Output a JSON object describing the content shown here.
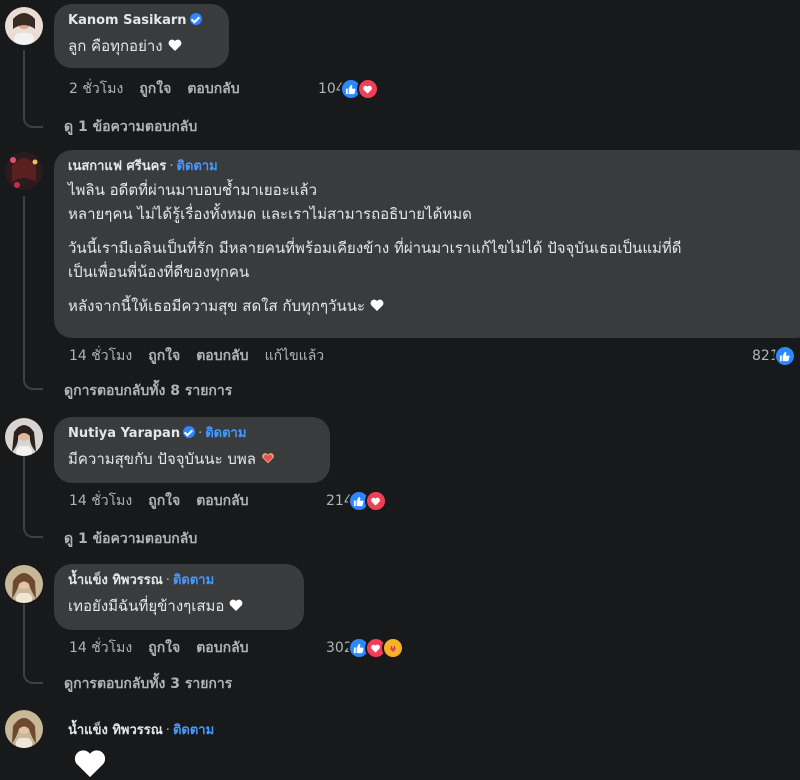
{
  "comments": [
    {
      "name": "Kanom Sasikarn",
      "verified": true,
      "follow": "",
      "lines": [
        "ลูก คือทุกอย่าง"
      ],
      "time": "2 ชั่วโมง",
      "like": "ถูกใจ",
      "reply": "ตอบกลับ",
      "edited": "",
      "reactions_count": "104",
      "view_replies": "ดู 1 ข้อความตอบกลับ"
    },
    {
      "name": "เนสกาแฟ ศรีนคร",
      "verified": false,
      "follow": "ติดตาม",
      "lines": [
        "ไพลิน อดีตที่ผ่านมาบอบช้ำมาเยอะแล้ว",
        "หลายๆคน ไม่ได้รู้เรื่องทั้งหมด และเราไม่สามารถอธิบายได้หมด",
        "วันนี้เรามีเอลินเป็นที่รัก มีหลายคนที่พร้อมเคียงข้าง ที่ผ่านมาเราแก้ไขไม่ได้ ปัจจุบันเธอเป็นแม่ที่ดี",
        "เป็นเพื่อนพี่น้องที่ดีของทุกคน",
        "หลังจากนี้ให้เธอมีความสุข สดใส กับทุกๆวันนะ"
      ],
      "time": "14 ชั่วโมง",
      "like": "ถูกใจ",
      "reply": "ตอบกลับ",
      "edited": "แก้ไขแล้ว",
      "reactions_count": "821",
      "view_replies": "ดูการตอบกลับทั้ง 8 รายการ"
    },
    {
      "name": "Nutiya Yarapan",
      "verified": true,
      "follow": "ติดตาม",
      "lines": [
        "มีความสุขกับ ปัจจุบันนะ บพล"
      ],
      "time": "14 ชั่วโมง",
      "like": "ถูกใจ",
      "reply": "ตอบกลับ",
      "edited": "",
      "reactions_count": "214",
      "view_replies": "ดู 1 ข้อความตอบกลับ"
    },
    {
      "name": "น้ำแข็ง ทิพวรรณ",
      "verified": false,
      "follow": "ติดตาม",
      "lines": [
        "เทอยังมีฉันที่ยุข้างๆเสมอ"
      ],
      "time": "14 ชั่วโมง",
      "like": "ถูกใจ",
      "reply": "ตอบกลับ",
      "edited": "",
      "reactions_count": "302",
      "view_replies": "ดูการตอบกลับทั้ง 3 รายการ"
    },
    {
      "name": "น้ำแข็ง ทิพวรรณ",
      "verified": false,
      "follow": "ติดตาม",
      "lines": [],
      "time": "",
      "like": "",
      "reply": "",
      "edited": "",
      "reactions_count": "",
      "view_replies": ""
    }
  ],
  "colors": {
    "background": "#18191a",
    "bubble": "#3a3b3c",
    "follow_link": "#4599ff",
    "like_blue": "#2d88ff",
    "love_red": "#f33e58",
    "care_yellow": "#f7b125"
  },
  "icons": [
    "verified-badge-icon",
    "white-heart-icon",
    "like-reaction-icon",
    "love-reaction-icon",
    "care-reaction-icon",
    "heart-hands-emoji-icon"
  ]
}
